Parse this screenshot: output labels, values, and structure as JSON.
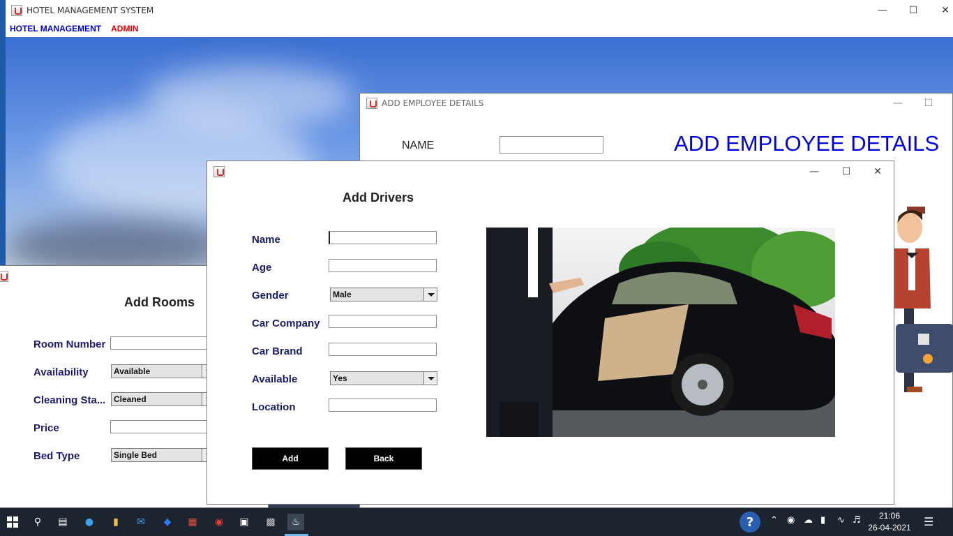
{
  "main_window": {
    "title": "HOTEL MANAGEMENT SYSTEM",
    "menu": [
      {
        "label": "HOTEL MANAGEMENT",
        "color": "#0000cc"
      },
      {
        "label": "ADMIN",
        "color": "#e00000"
      }
    ]
  },
  "employee_window": {
    "title": "ADD EMPLOYEE DETAILS",
    "heading": "ADD EMPLOYEE DETAILS",
    "name_label": "NAME",
    "name_value": ""
  },
  "rooms_window": {
    "heading": "Add Rooms",
    "fields": {
      "room_number_label": "Room Number",
      "room_number_value": "",
      "availability_label": "Availability",
      "availability_value": "Available",
      "cleaning_label": "Cleaning Sta...",
      "cleaning_value": "Cleaned",
      "price_label": "Price",
      "price_value": "",
      "bed_label": "Bed Type",
      "bed_value": "Single Bed"
    }
  },
  "drivers_window": {
    "title": "",
    "heading": "Add Drivers",
    "fields": {
      "name_label": "Name",
      "name_value": "",
      "age_label": "Age",
      "age_value": "",
      "gender_label": "Gender",
      "gender_value": "Male",
      "company_label": "Car Company",
      "company_value": "",
      "brand_label": "Car Brand",
      "brand_value": "",
      "available_label": "Available",
      "available_value": "Yes",
      "location_label": "Location",
      "location_value": ""
    },
    "add_label": "Add",
    "back_label": "Back"
  },
  "taskbar": {
    "time": "21:06",
    "date": "26-04-2021"
  },
  "colors": {
    "label": "#1b1b6b",
    "heading_blue": "#0000dd",
    "taskbar": "#1c2430"
  }
}
